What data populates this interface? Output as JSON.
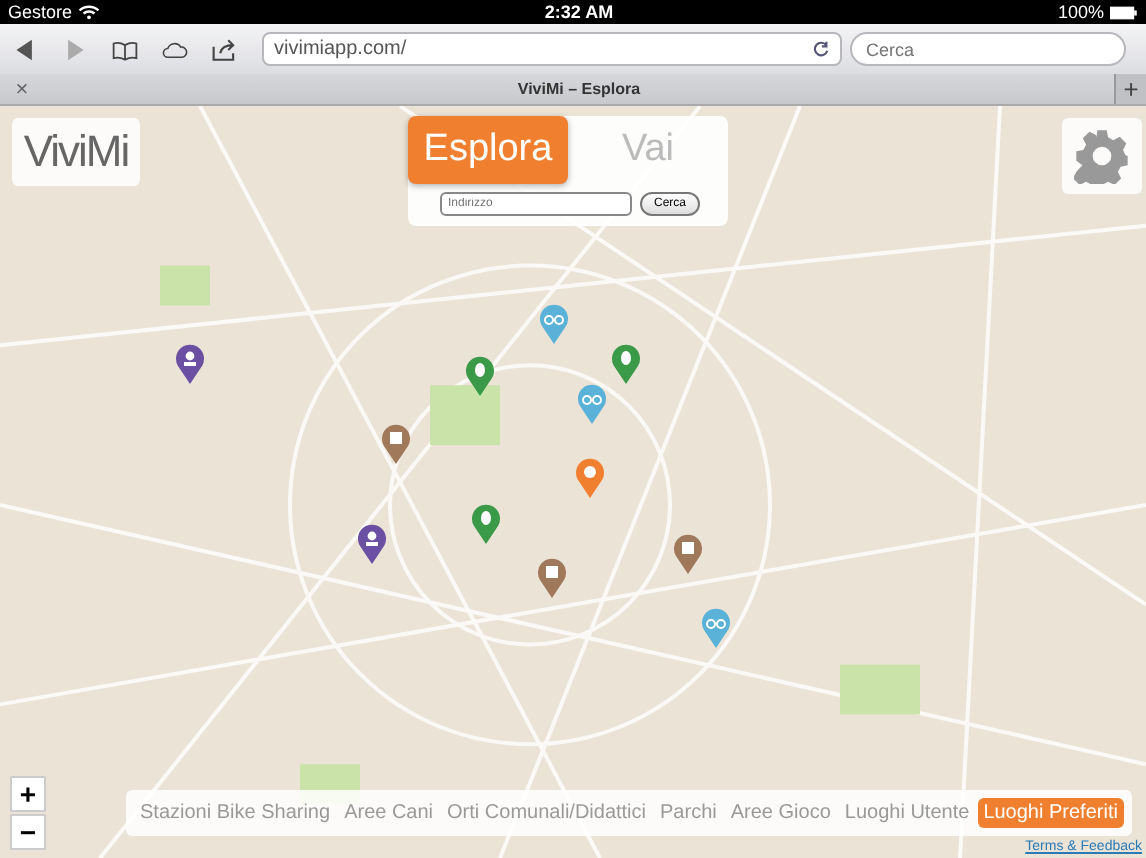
{
  "status_bar": {
    "carrier": "Gestore",
    "time": "2:32 AM",
    "battery": "100%"
  },
  "browser": {
    "url": "vivimiapp.com/",
    "search": {
      "placeholder": "Cerca"
    },
    "tab_title": "ViviMi – Esplora",
    "close_tab": "×",
    "new_tab": "+"
  },
  "app": {
    "logo": "ViviMi",
    "modes": [
      {
        "label": "Esplora",
        "selected": true
      },
      {
        "label": "Vai",
        "selected": false
      }
    ],
    "address": {
      "placeholder": "Indirizzo"
    },
    "search_button": "Cerca",
    "pins": [
      {
        "kind": "people",
        "color": "#6a4fa3"
      },
      {
        "kind": "people",
        "color": "#6a4fa3"
      },
      {
        "kind": "list",
        "color": "#a0785a"
      },
      {
        "kind": "list",
        "color": "#a0785a"
      },
      {
        "kind": "list",
        "color": "#a0785a"
      },
      {
        "kind": "leaf",
        "color": "#3a9a48"
      },
      {
        "kind": "leaf",
        "color": "#3a9a48"
      },
      {
        "kind": "leaf",
        "color": "#3a9a48"
      },
      {
        "kind": "bike",
        "color": "#5ab2d8"
      },
      {
        "kind": "bike",
        "color": "#5ab2d8"
      },
      {
        "kind": "bike",
        "color": "#5ab2d8"
      },
      {
        "kind": "dog",
        "color": "#f08030"
      }
    ],
    "zoom_in": "+",
    "zoom_out": "−",
    "filters": [
      {
        "label": "Stazioni Bike Sharing",
        "selected": false
      },
      {
        "label": "Aree Cani",
        "selected": false
      },
      {
        "label": "Orti Comunali/Didattici",
        "selected": false
      },
      {
        "label": "Parchi",
        "selected": false
      },
      {
        "label": "Aree Gioco",
        "selected": false
      },
      {
        "label": "Luoghi Utente",
        "selected": false
      },
      {
        "label": "Luoghi Preferiti",
        "selected": true
      }
    ],
    "terms_link": "Terms & Feedback"
  }
}
